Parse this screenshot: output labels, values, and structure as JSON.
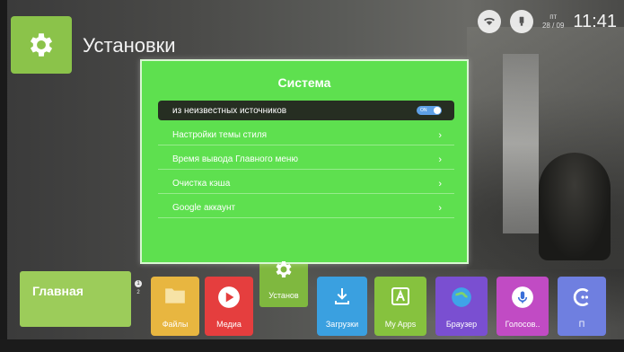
{
  "header": {
    "title": "Установки",
    "day": "пт",
    "date": "28 / 09",
    "time": "11:41"
  },
  "dialog": {
    "title": "Система",
    "toggle_state": "ON",
    "rows": [
      {
        "label": "из неизвестных источников"
      },
      {
        "label": "Настройки темы стиля"
      },
      {
        "label": "Время вывода Главного меню"
      },
      {
        "label": "Очистка кэша"
      },
      {
        "label": "Google аккаунт"
      }
    ]
  },
  "dock": {
    "home": "Главная",
    "page_1": "1",
    "page_2": "2",
    "apps": [
      {
        "label": "Файлы",
        "color": "#e8b640"
      },
      {
        "label": "Медиа",
        "color": "#e53e3e"
      },
      {
        "label": "Установ",
        "color": "#7fb83f"
      },
      {
        "label": "Загрузки",
        "color": "#3aa0e0"
      },
      {
        "label": "My Apps",
        "color": "#86c23e"
      },
      {
        "label": "Браузер",
        "color": "#7a4fd1"
      },
      {
        "label": "Голосов..",
        "color": "#c14bc4"
      },
      {
        "label": "П",
        "color": "#6f7fe0"
      }
    ]
  }
}
